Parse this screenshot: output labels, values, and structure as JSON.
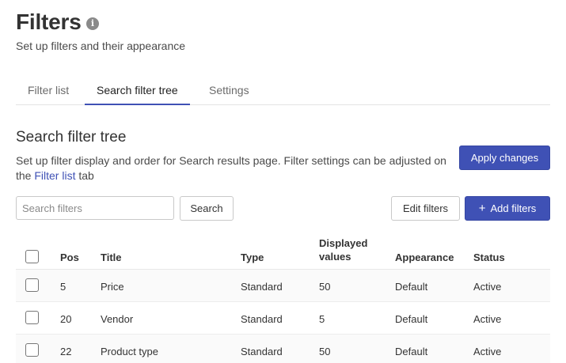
{
  "header": {
    "title": "Filters",
    "info_icon": "i",
    "subtitle": "Set up filters and their appearance"
  },
  "tabs": [
    {
      "label": "Filter list",
      "active": false
    },
    {
      "label": "Search filter tree",
      "active": true
    },
    {
      "label": "Settings",
      "active": false
    }
  ],
  "section": {
    "title": "Search filter tree",
    "description_before": "Set up filter display and order for Search results page. Filter settings can be adjusted on the ",
    "description_link": "Filter list",
    "description_after": " tab",
    "apply_label": "Apply changes"
  },
  "toolbar": {
    "search_placeholder": "Search filters",
    "search_label": "Search",
    "edit_label": "Edit filters",
    "add_label": "Add filters",
    "add_icon": "+"
  },
  "table": {
    "headers": {
      "pos": "Pos",
      "title": "Title",
      "type": "Type",
      "displayed_line1": "Displayed",
      "displayed_line2": "values",
      "appearance": "Appearance",
      "status": "Status"
    },
    "rows": [
      {
        "pos": "5",
        "title": "Price",
        "type": "Standard",
        "displayed": "50",
        "appearance": "Default",
        "status": "Active"
      },
      {
        "pos": "20",
        "title": "Vendor",
        "type": "Standard",
        "displayed": "5",
        "appearance": "Default",
        "status": "Active"
      },
      {
        "pos": "22",
        "title": "Product type",
        "type": "Standard",
        "displayed": "50",
        "appearance": "Default",
        "status": "Active"
      }
    ]
  },
  "colors": {
    "accent": "#3f51b5",
    "text": "#333333",
    "muted": "#6b6b6b"
  }
}
